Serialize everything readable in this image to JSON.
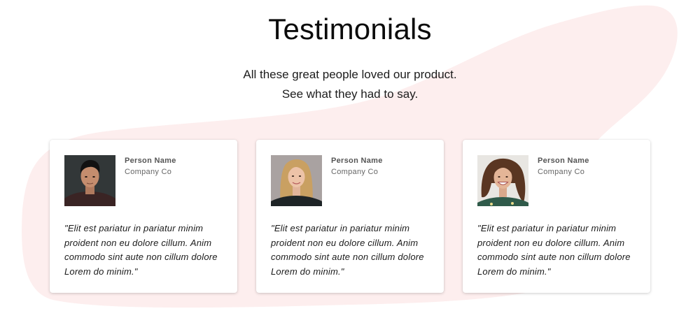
{
  "colors": {
    "background": "#ffffff",
    "blob": "#fdeeee",
    "card": "#ffffff"
  },
  "page": {
    "title": "Testimonials",
    "subtitle_line1": "All these great people loved our product.",
    "subtitle_line2": "See what they had to say."
  },
  "testimonials": [
    {
      "name": "Person Name",
      "company": "Company Co",
      "quote": "\"Elit est pariatur in pariatur minim proident non eu dolore cillum. Anim commodo sint aute non cillum dolore Lorem do minim.\"",
      "photo": "person-photo-1"
    },
    {
      "name": "Person Name",
      "company": "Company Co",
      "quote": "\"Elit est pariatur in pariatur minim proident non eu dolore cillum. Anim commodo sint aute non cillum dolore Lorem do minim.\"",
      "photo": "person-photo-2"
    },
    {
      "name": "Person Name",
      "company": "Company Co",
      "quote": "\"Elit est pariatur in pariatur minim proident non eu dolore cillum. Anim commodo sint aute non cillum dolore Lorem do minim.\"",
      "photo": "person-photo-3"
    }
  ]
}
